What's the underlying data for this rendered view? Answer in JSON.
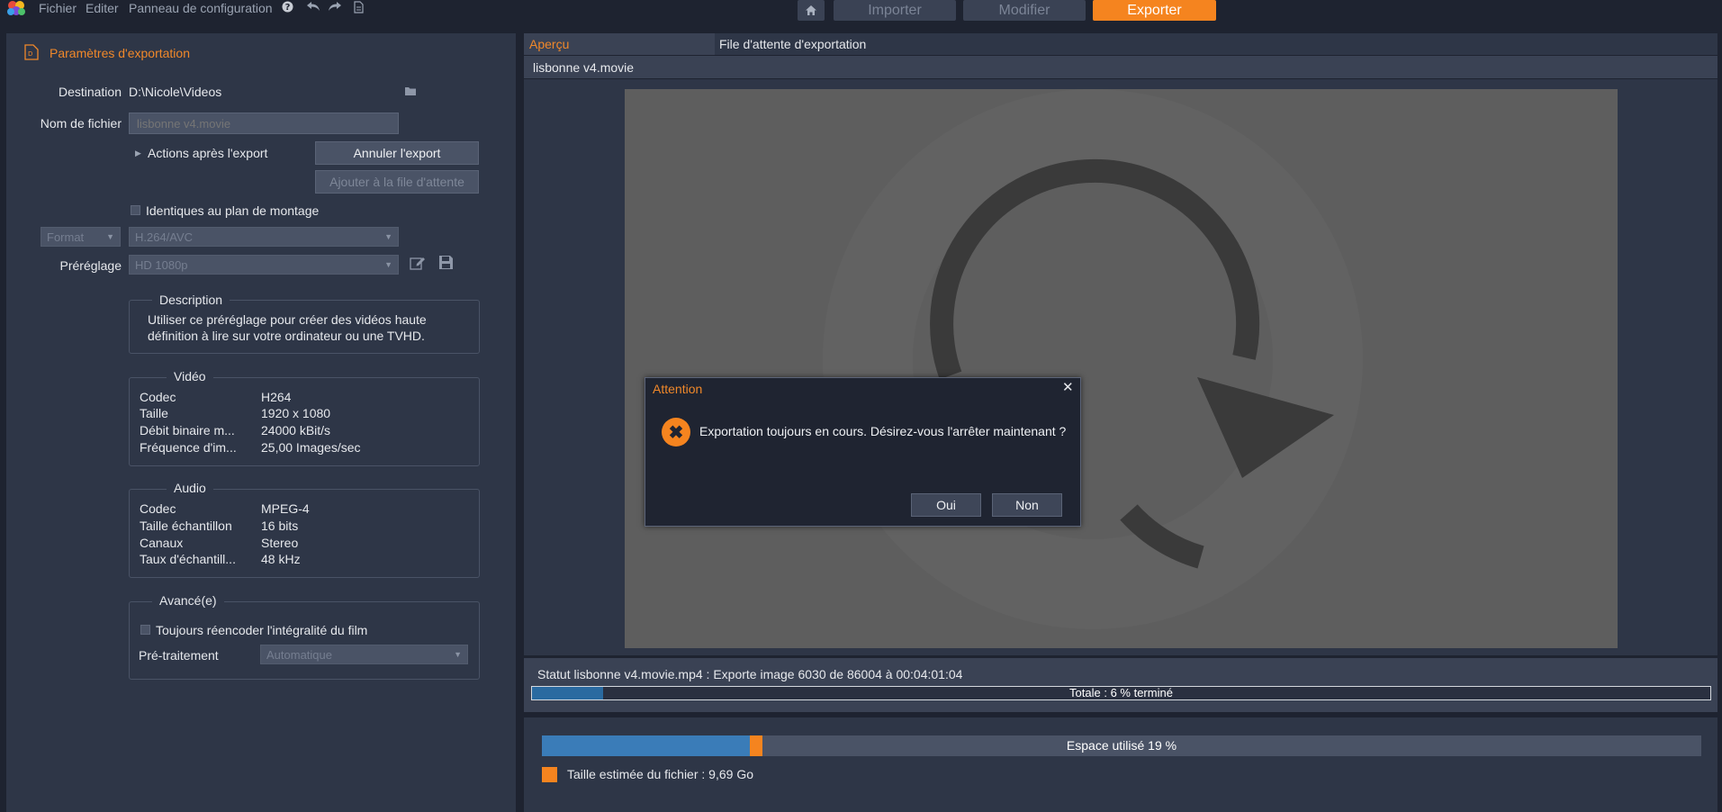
{
  "menu": {
    "file": "Fichier",
    "edit": "Editer",
    "control_panel": "Panneau de configuration"
  },
  "nav": {
    "import": "Importer",
    "edit": "Modifier",
    "export": "Exporter"
  },
  "export_settings": {
    "title": "Paramètres d'exportation",
    "destination_label": "Destination",
    "destination_value": "D:\\Nicole\\Videos",
    "filename_label": "Nom de fichier",
    "filename_placeholder": "lisbonne v4.movie",
    "after_export_label": "Actions après l'export",
    "cancel_export_button": "Annuler l'export",
    "add_to_queue_button": "Ajouter à la file d'attente",
    "same_as_timeline_label": "Identiques au plan de montage",
    "format_label": "Format",
    "format_value": "H.264/AVC",
    "preset_label": "Préréglage",
    "preset_value": "HD 1080p",
    "description_title": "Description",
    "description_text": "Utiliser ce préréglage pour créer des vidéos haute définition à lire sur votre ordinateur ou une TVHD.",
    "video_title": "Vidéo",
    "video_rows": [
      {
        "key": "Codec",
        "value": "H264"
      },
      {
        "key": "Taille",
        "value": "1920 x 1080"
      },
      {
        "key": "Débit binaire m...",
        "value": "24000 kBit/s"
      },
      {
        "key": "Fréquence d'im...",
        "value": "25,00 Images/sec"
      }
    ],
    "audio_title": "Audio",
    "audio_rows": [
      {
        "key": "Codec",
        "value": "MPEG-4"
      },
      {
        "key": "Taille échantillon",
        "value": "16 bits"
      },
      {
        "key": "Canaux",
        "value": "Stereo"
      },
      {
        "key": "Taux d'échantill...",
        "value": "48 kHz"
      }
    ],
    "advanced_title": "Avancé(e)",
    "reencode_label": "Toujours réencoder l'intégralité du film",
    "preprocessing_label": "Pré-traitement",
    "preprocessing_value": "Automatique"
  },
  "tabs": {
    "preview": "Aperçu",
    "queue": "File d'attente d'exportation"
  },
  "preview": {
    "file_title": "lisbonne v4.movie"
  },
  "status": {
    "text": "Statut lisbonne v4.movie.mp4 : Exporte image 6030 de 86004 à 00:04:01:04",
    "progress_label": "Totale : 6 % terminé",
    "progress_fraction": 0.06
  },
  "space": {
    "label": "Espace utilisé 19 %",
    "used_fraction": 0.19,
    "estimate_label": "Taille estimée du fichier : 9,69 Go"
  },
  "dialog": {
    "title": "Attention",
    "message": "Exportation toujours en cours. Désirez-vous l'arrêter maintenant ?",
    "yes": "Oui",
    "no": "Non"
  },
  "colors": {
    "accent": "#f5841f",
    "progress": "#2a6aa0",
    "space_used": "#3a7cb8"
  }
}
